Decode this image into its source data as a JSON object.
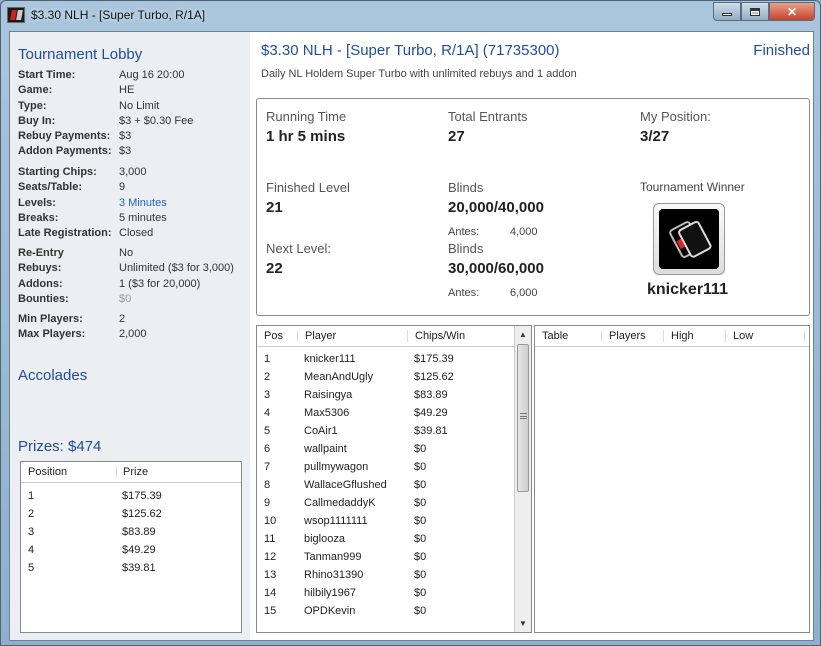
{
  "window": {
    "title": "$3.30 NLH - [Super Turbo, R/1A]"
  },
  "left": {
    "lobby_title": "Tournament Lobby",
    "info_group1": [
      {
        "label": "Start Time:",
        "value": "Aug 16 20:00"
      },
      {
        "label": "Game:",
        "value": "HE"
      },
      {
        "label": "Type:",
        "value": "No Limit"
      },
      {
        "label": "Buy In:",
        "value": "$3 + $0.30 Fee"
      },
      {
        "label": "Rebuy Payments:",
        "value": "$3"
      },
      {
        "label": "Addon Payments:",
        "value": "$3"
      }
    ],
    "info_group2": [
      {
        "label": "Starting Chips:",
        "value": "3,000"
      },
      {
        "label": "Seats/Table:",
        "value": "9"
      },
      {
        "label": "Levels:",
        "value": "3 Minutes"
      },
      {
        "label": "Breaks:",
        "value": "5 minutes"
      },
      {
        "label": "Late Registration:",
        "value": "Closed"
      }
    ],
    "info_group3": [
      {
        "label": "Re-Entry",
        "value": "No"
      },
      {
        "label": "Rebuys:",
        "value": "Unlimited ($3 for 3,000)"
      },
      {
        "label": "Addons:",
        "value": "1 ($3 for 20,000)"
      },
      {
        "label": "Bounties:",
        "value": "$0"
      }
    ],
    "info_group4": [
      {
        "label": "Min Players:",
        "value": "2"
      },
      {
        "label": "Max Players:",
        "value": "2,000"
      }
    ],
    "accolades_title": "Accolades",
    "prizes_title": "Prizes: $474",
    "prize_table": {
      "headers": [
        "Position",
        "Prize"
      ],
      "rows": [
        [
          "1",
          "$175.39"
        ],
        [
          "2",
          "$125.62"
        ],
        [
          "3",
          "$83.89"
        ],
        [
          "4",
          "$49.29"
        ],
        [
          "5",
          "$39.81"
        ]
      ]
    }
  },
  "tournament": {
    "name": "$3.30 NLH - [Super Turbo, R/1A] (71735300)",
    "description": "Daily NL Holdem Super Turbo with unlimited rebuys and 1 addon",
    "status": "Finished"
  },
  "stats": {
    "running_time_label": "Running Time",
    "running_time": "1 hr 5 mins",
    "total_entrants_label": "Total Entrants",
    "total_entrants": "27",
    "my_position_label": "My Position:",
    "my_position": "3/27",
    "finished_level_label": "Finished Level",
    "finished_level": "21",
    "blinds_label": "Blinds",
    "blinds": "20,000/40,000",
    "antes_label": "Antes:",
    "antes": "4,000",
    "next_level_label": "Next Level:",
    "next_level": "22",
    "next_blinds_label": "Blinds",
    "next_blinds": "30,000/60,000",
    "next_antes_label": "Antes:",
    "next_antes": "6,000",
    "winner_label": "Tournament Winner",
    "winner_name": "knicker111"
  },
  "players_table": {
    "headers": [
      "Pos",
      "Player",
      "Chips/Win"
    ],
    "rows": [
      [
        "1",
        "knicker111",
        "$175.39"
      ],
      [
        "2",
        "MeanAndUgly",
        "$125.62"
      ],
      [
        "3",
        "Raisingya",
        "$83.89"
      ],
      [
        "4",
        "Max5306",
        "$49.29"
      ],
      [
        "5",
        "CoAir1",
        "$39.81"
      ],
      [
        "6",
        "wallpaint",
        "$0"
      ],
      [
        "7",
        "pullmywagon",
        "$0"
      ],
      [
        "8",
        "WallaceGflushed",
        "$0"
      ],
      [
        "9",
        "CallmedaddyK",
        "$0"
      ],
      [
        "10",
        "wsop1111111",
        "$0"
      ],
      [
        "11",
        "biglooza",
        "$0"
      ],
      [
        "12",
        "Tanman999",
        "$0"
      ],
      [
        "13",
        "Rhino31390",
        "$0"
      ],
      [
        "14",
        "hilbily1967",
        "$0"
      ],
      [
        "15",
        "OPDKevin",
        "$0"
      ]
    ]
  },
  "tables_table": {
    "headers": [
      "Table",
      "Players",
      "High",
      "Low"
    ]
  },
  "colors": {
    "accent": "#1f4e9c",
    "link": "#1f64c8",
    "left_panel_bg": "#eceef1"
  }
}
